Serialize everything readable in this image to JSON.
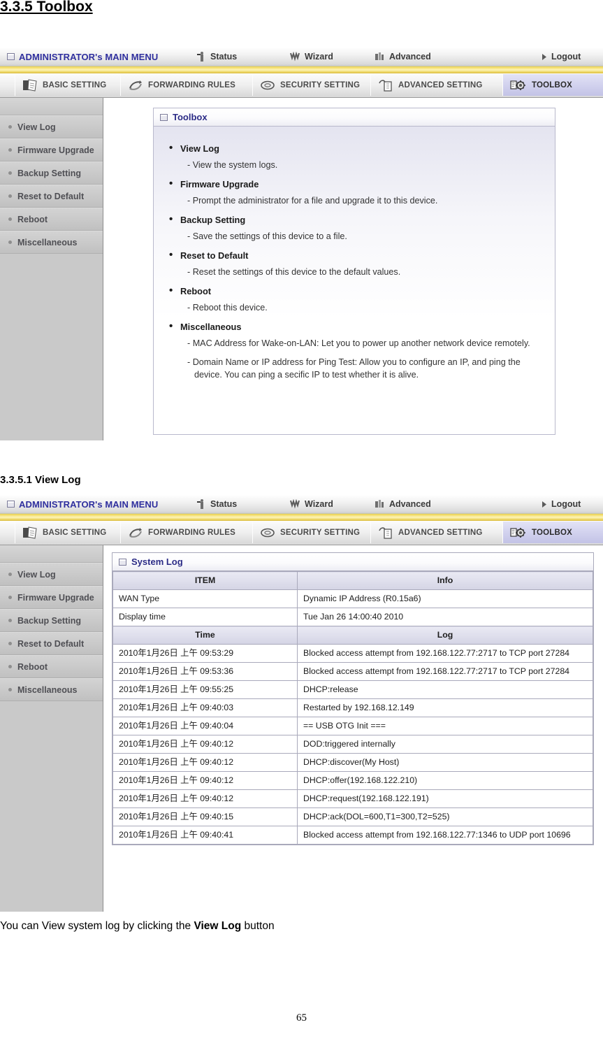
{
  "document": {
    "section_heading": "3.3.5 Toolbox",
    "subsection_heading": "3.3.5.1 View Log",
    "caption_prefix": "You can View system log by clicking the ",
    "caption_bold": "View Log",
    "caption_suffix": " button",
    "page_number": "65"
  },
  "router_ui": {
    "main_menu": {
      "admin_label": "ADMINISTRATOR's MAIN MENU",
      "items": [
        {
          "label": "Status",
          "icon": "status-icon"
        },
        {
          "label": "Wizard",
          "icon": "wizard-icon"
        },
        {
          "label": "Advanced",
          "icon": "advanced-icon"
        },
        {
          "label": "Logout",
          "icon": "arrow-right-icon"
        }
      ]
    },
    "tabs": [
      {
        "label": "BASIC SETTING",
        "icon": "folder-document-icon",
        "active": false
      },
      {
        "label": "FORWARDING RULES",
        "icon": "arrows-exchange-icon",
        "active": false
      },
      {
        "label": "SECURITY SETTING",
        "icon": "shield-disc-icon",
        "active": false
      },
      {
        "label": "ADVANCED SETTING",
        "icon": "building-gear-icon",
        "active": false
      },
      {
        "label": "TOOLBOX",
        "icon": "toolbox-gear-icon",
        "active": true
      }
    ],
    "sidebar": [
      {
        "label": "View Log"
      },
      {
        "label": "Firmware Upgrade"
      },
      {
        "label": "Backup Setting"
      },
      {
        "label": "Reset to Default"
      },
      {
        "label": "Reboot"
      },
      {
        "label": "Miscellaneous"
      }
    ],
    "toolbox_panel": {
      "title": "Toolbox",
      "entries": [
        {
          "name": "View Log",
          "descriptions": [
            "- View the system logs."
          ]
        },
        {
          "name": "Firmware Upgrade",
          "descriptions": [
            "- Prompt the administrator for a file and upgrade it to this device."
          ]
        },
        {
          "name": "Backup Setting",
          "descriptions": [
            "- Save the settings of this device to a file."
          ]
        },
        {
          "name": "Reset to Default",
          "descriptions": [
            "- Reset the settings of this device to the default values."
          ]
        },
        {
          "name": "Reboot",
          "descriptions": [
            "- Reboot this device."
          ]
        },
        {
          "name": "Miscellaneous",
          "descriptions": [
            "- MAC Address for Wake-on-LAN: Let you to power up another network device remotely.",
            "- Domain Name or IP address for Ping Test: Allow you to configure an IP, and ping the device. You can ping a secific IP to test whether it is alive."
          ]
        }
      ]
    },
    "system_log_panel": {
      "title": "System Log",
      "info_headers": [
        "ITEM",
        "Info"
      ],
      "info_rows": [
        [
          "WAN Type",
          "Dynamic IP Address (R0.15a6)"
        ],
        [
          "Display time",
          "Tue Jan 26 14:00:40 2010"
        ]
      ],
      "log_headers": [
        "Time",
        "Log"
      ],
      "log_rows": [
        [
          "2010年1月26日 上午 09:53:29",
          "Blocked access attempt from 192.168.122.77:2717 to TCP port 27284"
        ],
        [
          "2010年1月26日 上午 09:53:36",
          "Blocked access attempt from 192.168.122.77:2717 to TCP port 27284"
        ],
        [
          "2010年1月26日 上午 09:55:25",
          "DHCP:release"
        ],
        [
          "2010年1月26日 上午 09:40:03",
          "Restarted by 192.168.12.149"
        ],
        [
          "2010年1月26日 上午 09:40:04",
          "== USB OTG Init ==="
        ],
        [
          "2010年1月26日 上午 09:40:12",
          "DOD:triggered internally"
        ],
        [
          "2010年1月26日 上午 09:40:12",
          "DHCP:discover(My Host)"
        ],
        [
          "2010年1月26日 上午 09:40:12",
          "DHCP:offer(192.168.122.210)"
        ],
        [
          "2010年1月26日 上午 09:40:12",
          "DHCP:request(192.168.122.191)"
        ],
        [
          "2010年1月26日 上午 09:40:15",
          "DHCP:ack(DOL=600,T1=300,T2=525)"
        ],
        [
          "2010年1月26日 上午 09:40:41",
          "Blocked access attempt from 192.168.122.77:1346 to UDP port 10696"
        ]
      ]
    }
  },
  "colors": {
    "accent_yellow": "#f3de72",
    "menu_blue": "#2f2f9e",
    "tab_active": "#d2d2ee",
    "sidebar_grey": "#c9c9c9",
    "table_header": "#dedeec"
  }
}
